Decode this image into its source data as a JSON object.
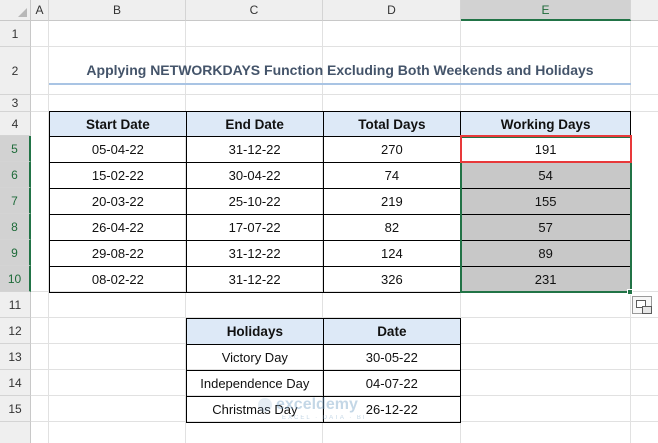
{
  "columns": [
    "A",
    "B",
    "C",
    "D",
    "E"
  ],
  "rows": [
    "1",
    "2",
    "3",
    "4",
    "5",
    "6",
    "7",
    "8",
    "9",
    "10",
    "11",
    "12",
    "13",
    "14",
    "15"
  ],
  "selected_column": "E",
  "title": "Applying NETWORKDAYS Function Excluding Both Weekends and Holidays",
  "main_table": {
    "headers": [
      "Start Date",
      "End Date",
      "Total Days",
      "Working Days"
    ],
    "rows": [
      [
        "05-04-22",
        "31-12-22",
        "270",
        "191"
      ],
      [
        "15-02-22",
        "30-04-22",
        "74",
        "54"
      ],
      [
        "20-03-22",
        "25-10-22",
        "219",
        "155"
      ],
      [
        "26-04-22",
        "17-07-22",
        "82",
        "57"
      ],
      [
        "29-08-22",
        "31-12-22",
        "124",
        "89"
      ],
      [
        "08-02-22",
        "31-12-22",
        "326",
        "231"
      ]
    ]
  },
  "holidays_table": {
    "headers": [
      "Holidays",
      "Date"
    ],
    "rows": [
      [
        "Victory Day",
        "30-05-22"
      ],
      [
        "Independence Day",
        "04-07-22"
      ],
      [
        "Christmas Day",
        "26-12-22"
      ]
    ]
  },
  "watermark": {
    "name": "exceldemy",
    "tagline": "EXCEL · DATA · BI"
  },
  "colors": {
    "header_fill": "#dde9f7",
    "selection_green": "#217346",
    "active_cell_border": "#e8393a",
    "selected_fill": "#c8c8c8"
  },
  "icons": [
    "quick-analysis-icon",
    "fill-handle",
    "exceldemy-logo-icon"
  ]
}
